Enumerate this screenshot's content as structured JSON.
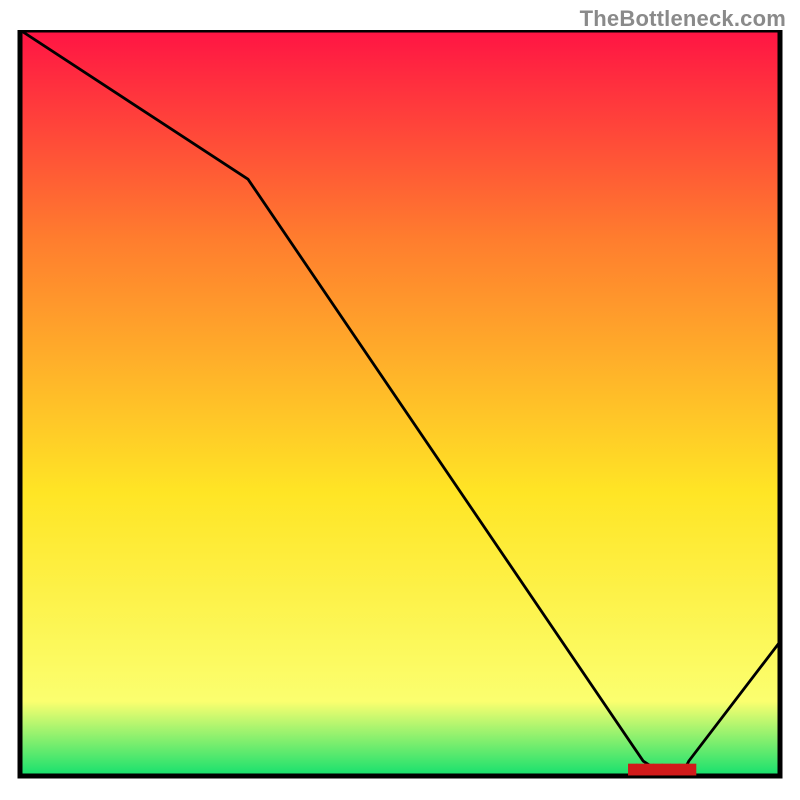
{
  "watermark": "TheBottleneck.com",
  "chart_data": {
    "type": "line",
    "title": "",
    "xlabel": "",
    "ylabel": "",
    "xlim": [
      0,
      100
    ],
    "ylim": [
      0,
      100
    ],
    "grid": false,
    "legend": false,
    "x": [
      0,
      30,
      82,
      85,
      87,
      88,
      100
    ],
    "values": [
      100,
      80,
      2,
      0,
      0,
      2,
      18
    ],
    "gradient_colors": {
      "top": "#ff1444",
      "mid_upper": "#ff7d2e",
      "mid_lower": "#ffe525",
      "near_bottom": "#fbff6f",
      "bottom": "#14e06e"
    },
    "annotation": {
      "text": "▇▇▇▇▇▇▇▇",
      "color": "#d11a1a",
      "x": 84.5,
      "y": 0.5
    }
  }
}
